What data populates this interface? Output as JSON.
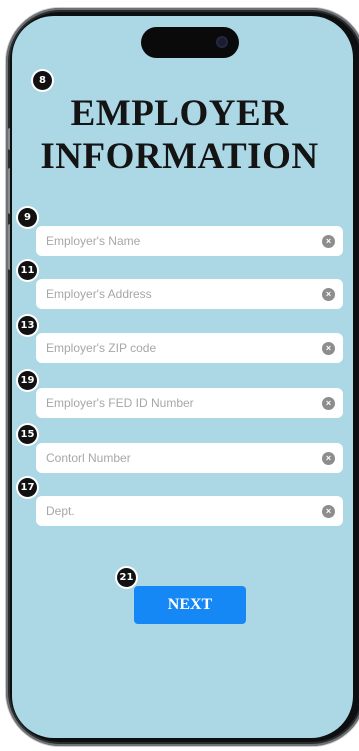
{
  "title": {
    "line1": "EMPLOYER",
    "line2": "INFORMATION"
  },
  "fields": [
    {
      "badge": "9",
      "placeholder": "Employer's Name",
      "clear_icon": "clear-circle-icon"
    },
    {
      "badge": "11",
      "placeholder": "Employer's Address",
      "clear_icon": "clear-circle-icon"
    },
    {
      "badge": "13",
      "placeholder": "Employer's ZIP code",
      "clear_icon": "clear-circle-icon"
    },
    {
      "badge": "19",
      "placeholder": "Employer's FED ID Number",
      "clear_icon": "clear-circle-icon"
    },
    {
      "badge": "15",
      "placeholder": "Contorl Number",
      "clear_icon": "clear-circle-icon"
    },
    {
      "badge": "17",
      "placeholder": "Dept.",
      "clear_icon": "clear-circle-icon"
    }
  ],
  "title_badge": "8",
  "next": {
    "label": "NEXT",
    "badge": "21"
  },
  "colors": {
    "screen_bg": "#acd8e6",
    "button_bg": "#1588f5",
    "field_bg": "#ffffff",
    "placeholder": "#a7a7a7"
  }
}
